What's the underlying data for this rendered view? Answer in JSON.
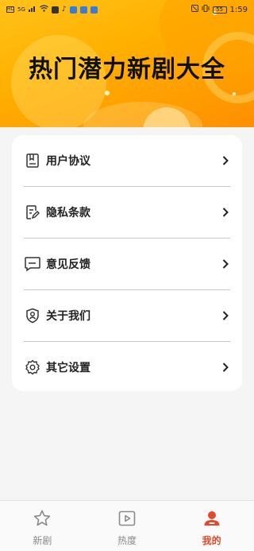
{
  "status_bar": {
    "left_badges": [
      "HD",
      "5G"
    ],
    "battery": "55",
    "time": "1:59"
  },
  "header": {
    "title": "热门潜力新剧大全"
  },
  "menu": {
    "items": [
      {
        "label": "用户协议",
        "icon": "document-icon"
      },
      {
        "label": "隐私条款",
        "icon": "edit-document-icon"
      },
      {
        "label": "意见反馈",
        "icon": "feedback-chat-icon"
      },
      {
        "label": "关于我们",
        "icon": "shield-user-icon"
      },
      {
        "label": "其它设置",
        "icon": "gear-icon"
      }
    ]
  },
  "tabbar": {
    "tabs": [
      {
        "label": "新剧",
        "icon": "star-icon",
        "active": false
      },
      {
        "label": "热度",
        "icon": "play-icon",
        "active": false
      },
      {
        "label": "我的",
        "icon": "user-icon",
        "active": true
      }
    ]
  },
  "colors": {
    "hero_start": "#ffc21a",
    "hero_end": "#ff8f00",
    "accent": "#e14b2c",
    "background": "#f5f5f5"
  }
}
